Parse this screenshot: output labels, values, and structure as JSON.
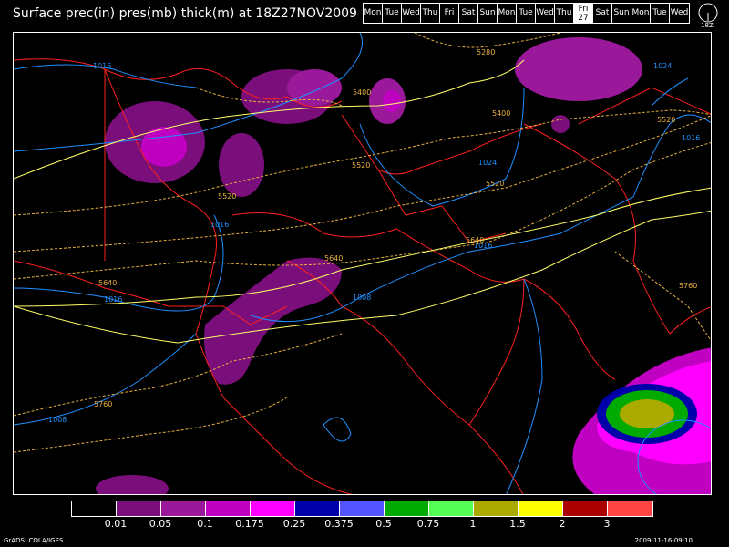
{
  "title": "Surface prec(in) pres(mb) thick(m) at 18Z27NOV2009",
  "days": [
    "Mon",
    "Tue",
    "Wed",
    "Thu",
    "Fri",
    "Sat",
    "Sun",
    "Mon",
    "Tue",
    "Wed",
    "Thu",
    "Fri",
    "Sat",
    "Sun",
    "Mon",
    "Tue",
    "Wed"
  ],
  "active_day": {
    "name": "Fri",
    "date": "27"
  },
  "clock_label": "18Z",
  "colorbar": {
    "colors": [
      "#000000",
      "#7a0e7a",
      "#9a189a",
      "#c000c0",
      "#ff00ff",
      "#0000aa",
      "#5555ff",
      "#00aa00",
      "#55ff55",
      "#aaaa00",
      "#ffff00",
      "#aa0000",
      "#ff4444"
    ],
    "labels": [
      "0.01",
      "0.05",
      "0.1",
      "0.175",
      "0.25",
      "0.375",
      "0.5",
      "0.75",
      "1",
      "1.5",
      "2",
      "3"
    ]
  },
  "contour_labels": {
    "thickness": [
      "5280",
      "5400",
      "5400",
      "5520",
      "5520",
      "5520",
      "5520",
      "5640",
      "5640",
      "5640",
      "5760",
      "5760"
    ],
    "pressure": [
      "1016",
      "1024",
      "1024",
      "1016",
      "1016",
      "1016",
      "1016",
      "1008",
      "1008"
    ]
  },
  "colors": {
    "coast": "#ff2020",
    "pressure": "#1e90ff",
    "thick_warm": "#ffff66",
    "thick_dash": "#e8b040"
  },
  "footer": {
    "left": "GrADS: COLA/IGES",
    "right": "2009-11-16-09:10"
  }
}
